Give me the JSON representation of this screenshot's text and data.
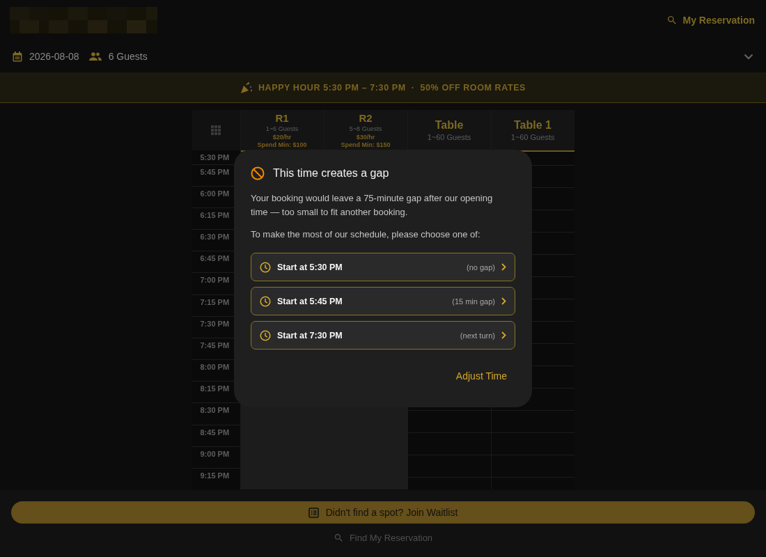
{
  "header": {
    "my_reservation": "My Reservation"
  },
  "filters": {
    "date": "2026-08-08",
    "guests": "6 Guests"
  },
  "banner": {
    "headline": "HAPPY HOUR 5:30 PM – 7:30 PM",
    "separator": "·",
    "offer": "50% OFF ROOM RATES"
  },
  "grid": {
    "columns": [
      {
        "name": "R1",
        "guests": "1~6 Guests",
        "rate": "$20/hr",
        "spend_min": "Spend Min: $100",
        "unavailable": true
      },
      {
        "name": "R2",
        "guests": "5~8 Guests",
        "rate": "$30/hr",
        "spend_min": "Spend Min: $150",
        "unavailable": true
      },
      {
        "name": "Table",
        "guests": "1~60 Guests",
        "unavailable": false
      },
      {
        "name": "Table 1",
        "guests": "1~60 Guests",
        "unavailable": false
      }
    ],
    "times": [
      "5:30 PM",
      "5:45 PM",
      "6:00 PM",
      "6:15 PM",
      "6:30 PM",
      "6:45 PM",
      "7:00 PM",
      "7:15 PM",
      "7:30 PM",
      "7:45 PM",
      "8:00 PM",
      "8:15 PM",
      "8:30 PM",
      "8:45 PM",
      "9:00 PM",
      "9:15 PM"
    ]
  },
  "dialog": {
    "title": "This time creates a gap",
    "paragraphs": [
      "Your booking would leave a 75-minute gap after our opening time — too small to fit another booking.",
      "To make the most of our schedule, please choose one of:"
    ],
    "options": [
      {
        "label": "Start at 5:30 PM",
        "note": "(no gap)"
      },
      {
        "label": "Start at 5:45 PM",
        "note": "(15 min gap)"
      },
      {
        "label": "Start at 7:30 PM",
        "note": "(next turn)"
      }
    ],
    "action": "Adjust Time"
  },
  "footer": {
    "waitlist": "Didn't find a spot? Join Waitlist",
    "find": "Find My Reservation"
  }
}
